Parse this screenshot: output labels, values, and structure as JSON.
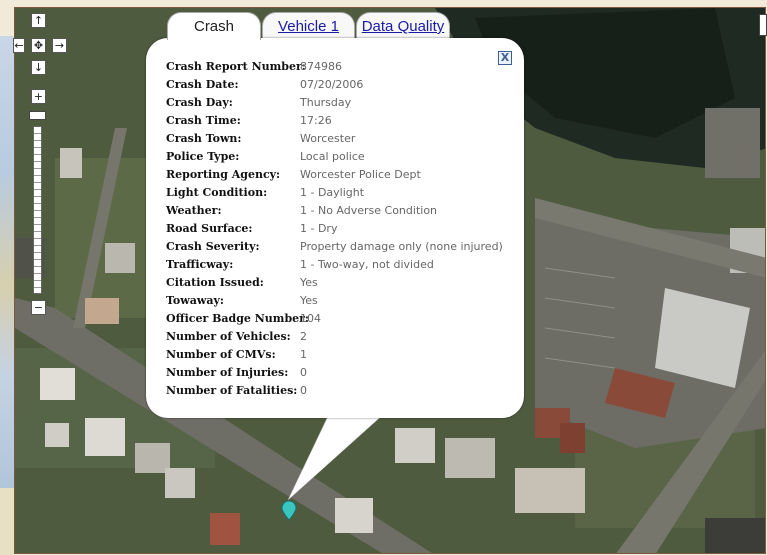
{
  "tabs": [
    {
      "label": "Crash",
      "active": true
    },
    {
      "label": "Vehicle 1",
      "active": false
    },
    {
      "label": "Data Quality",
      "active": false
    }
  ],
  "close_label": "X",
  "controls": {
    "pan_up": "↑",
    "pan_left": "←",
    "pan_center": "✥",
    "pan_right": "→",
    "pan_down": "↓",
    "zoom_in": "+",
    "zoom_out": "−"
  },
  "crash_details": [
    {
      "label": "Crash Report Number:",
      "value": "874986"
    },
    {
      "label": "Crash Date:",
      "value": "07/20/2006"
    },
    {
      "label": "Crash Day:",
      "value": "Thursday"
    },
    {
      "label": "Crash Time:",
      "value": "17:26"
    },
    {
      "label": "Crash Town:",
      "value": "Worcester"
    },
    {
      "label": "Police Type:",
      "value": "Local police"
    },
    {
      "label": "Reporting Agency:",
      "value": "Worcester Police Dept"
    },
    {
      "label": "Light Condition:",
      "value": "1 - Daylight"
    },
    {
      "label": "Weather:",
      "value": "1 - No Adverse Condition"
    },
    {
      "label": "Road Surface:",
      "value": "1 - Dry"
    },
    {
      "label": "Crash Severity:",
      "value": "Property damage only (none injured)"
    },
    {
      "label": "Trafficway:",
      "value": "1 - Two-way, not divided"
    },
    {
      "label": "Citation Issued:",
      "value": "Yes"
    },
    {
      "label": "Towaway:",
      "value": "Yes"
    },
    {
      "label": "Officer Badge Number:",
      "value": "104"
    },
    {
      "label": "Number of Vehicles:",
      "value": "2"
    },
    {
      "label": "Number of CMVs:",
      "value": "1"
    },
    {
      "label": "Number of Injuries:",
      "value": "0"
    },
    {
      "label": "Number of Fatalities:",
      "value": "0"
    }
  ],
  "colors": {
    "link": "#1a1aa8",
    "marker": "#39c6c0",
    "map_border": "#7b5a3c"
  }
}
